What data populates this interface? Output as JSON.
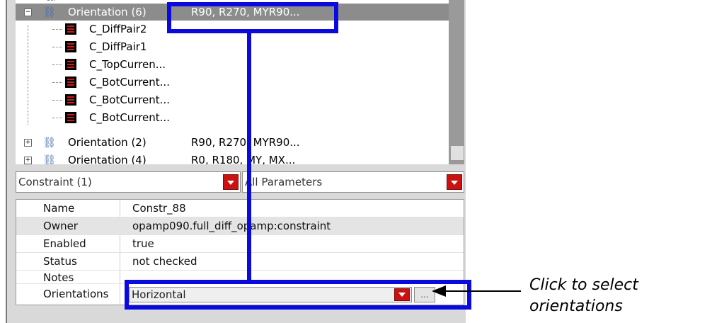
{
  "tree": {
    "rows": [
      {
        "label": "Orientation (6)",
        "value": "R90, R270, MYR90..."
      },
      {
        "label": "C_DiffPair2"
      },
      {
        "label": "C_DiffPair1"
      },
      {
        "label": "C_TopCurren..."
      },
      {
        "label": "C_BotCurrent..."
      },
      {
        "label": "C_BotCurrent..."
      },
      {
        "label": "C_BotCurrent..."
      },
      {
        "label": "Orientation (2)",
        "value": "R90, R270, MYR90..."
      },
      {
        "label": "Orientation (4)",
        "value": "R0, R180, MY, MX..."
      }
    ]
  },
  "filters": {
    "constraint_label": "Constraint (1)",
    "params_label": "All Parameters"
  },
  "properties": {
    "rows": [
      {
        "name": "Name",
        "value": "Constr_88"
      },
      {
        "name": "Owner",
        "value": "opamp090.full_diff_opamp:constraint"
      },
      {
        "name": "Enabled",
        "value": "true"
      },
      {
        "name": "Status",
        "value": "not checked"
      },
      {
        "name": "Notes",
        "value": ""
      },
      {
        "name": "Orientations",
        "value": "Horizontal"
      }
    ],
    "ellipsis_label": "..."
  },
  "callout": {
    "line1": "Click to select",
    "line2": "orientations"
  },
  "colors": {
    "highlight": "#0a0ae0",
    "dropdown": "#cc1111"
  }
}
